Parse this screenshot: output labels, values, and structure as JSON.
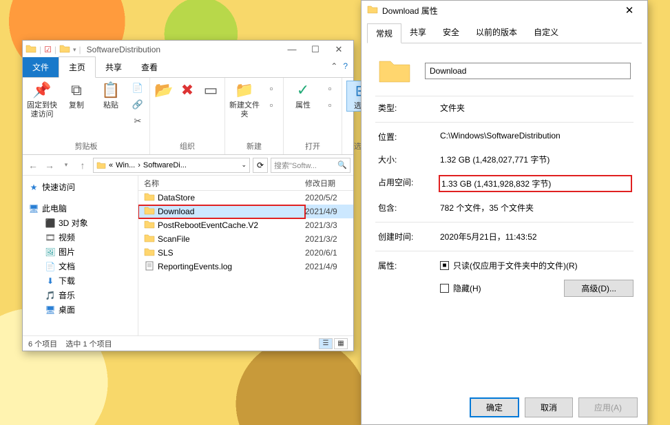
{
  "explorer": {
    "title": "SoftwareDistribution",
    "tabs": {
      "file": "文件",
      "home": "主页",
      "share": "共享",
      "view": "查看"
    },
    "ribbon": {
      "pin": "固定到快速访问",
      "copy": "复制",
      "paste": "粘贴",
      "clipboard_label": "剪贴板",
      "organize_label": "组织",
      "new_folder": "新建文件夹",
      "new_label": "新建",
      "properties": "属性",
      "open_label": "打开",
      "select": "选择",
      "select_label": "选择"
    },
    "breadcrumb": {
      "seg1": "Win...",
      "seg2": "SoftwareDi..."
    },
    "search_placeholder": "搜索\"Softw...",
    "tree": {
      "quick": "快速访问",
      "thispc": "此电脑",
      "objects3d": "3D 对象",
      "videos": "视频",
      "pictures": "图片",
      "documents": "文档",
      "downloads": "下载",
      "music": "音乐",
      "desktop": "桌面"
    },
    "list_headers": {
      "name": "名称",
      "date": "修改日期"
    },
    "files": [
      {
        "name": "DataStore",
        "date": "2020/5/2",
        "type": "folder"
      },
      {
        "name": "Download",
        "date": "2021/4/9",
        "type": "folder",
        "selected": true,
        "highlighted": true
      },
      {
        "name": "PostRebootEventCache.V2",
        "date": "2021/3/3",
        "type": "folder"
      },
      {
        "name": "ScanFile",
        "date": "2021/3/2",
        "type": "folder"
      },
      {
        "name": "SLS",
        "date": "2020/6/1",
        "type": "folder"
      },
      {
        "name": "ReportingEvents.log",
        "date": "2021/4/9",
        "type": "file"
      }
    ],
    "status": {
      "count": "6 个项目",
      "selected": "选中 1 个项目"
    }
  },
  "props": {
    "title": "Download 属性",
    "tabs": {
      "general": "常规",
      "share": "共享",
      "security": "安全",
      "prev": "以前的版本",
      "custom": "自定义"
    },
    "name_value": "Download",
    "rows": {
      "type_k": "类型:",
      "type_v": "文件夹",
      "loc_k": "位置:",
      "loc_v": "C:\\Windows\\SoftwareDistribution",
      "size_k": "大小:",
      "size_v": "1.32 GB (1,428,027,771 字节)",
      "disk_k": "占用空间:",
      "disk_v": "1.33 GB (1,431,928,832 字节)",
      "contains_k": "包含:",
      "contains_v": "782 个文件，35 个文件夹",
      "created_k": "创建时间:",
      "created_v": "2020年5月21日，11:43:52",
      "attr_k": "属性:",
      "readonly": "只读(仅应用于文件夹中的文件)(R)",
      "hidden": "隐藏(H)",
      "advanced": "高级(D)..."
    },
    "buttons": {
      "ok": "确定",
      "cancel": "取消",
      "apply": "应用(A)"
    }
  }
}
